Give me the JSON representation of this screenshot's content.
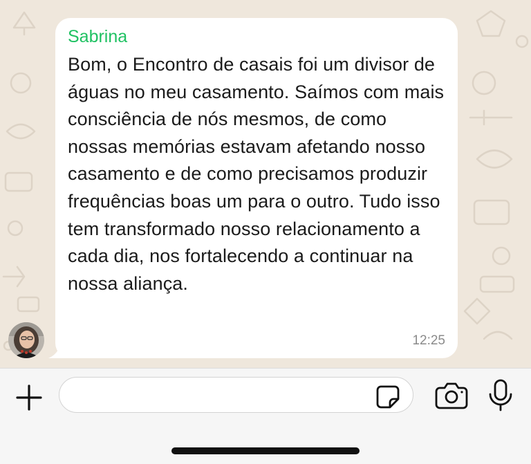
{
  "conversation": {
    "message": {
      "sender": "Sabrina",
      "text": "Bom, o Encontro de casais foi um divisor de águas no meu casamento. Saímos com mais consciência de nós mesmos, de como nossas memórias estavam afetando nosso casamento e de como precisamos produzir frequências boas um para o outro. Tudo isso tem transformado nosso relacionamento a cada dia, nos fortalecendo a continuar na nossa aliança.",
      "time": "12:25"
    },
    "colors": {
      "sender_name": "#1fc162",
      "chat_background": "#efe7dc",
      "bubble": "#ffffff"
    }
  },
  "composer": {
    "input_value": "",
    "icons": {
      "attach": "plus-icon",
      "sticker": "sticker-icon",
      "camera": "camera-icon",
      "voice": "microphone-icon"
    }
  }
}
